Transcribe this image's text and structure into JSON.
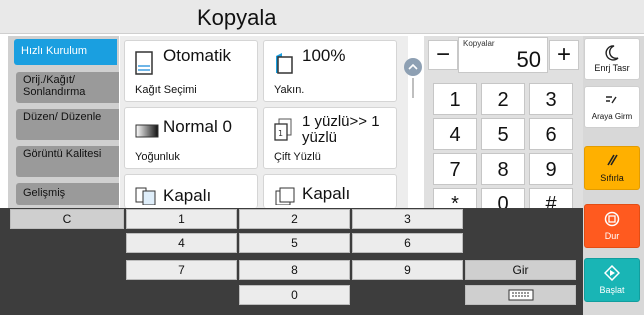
{
  "title": "Kopyala",
  "sidebar": {
    "items": [
      {
        "label": "Hızlı Kurulum",
        "active": true
      },
      {
        "label": "Orij./Kağıt/ Sonlandırma",
        "active": false
      },
      {
        "label": "Düzen/ Düzenle",
        "active": false
      },
      {
        "label": "Görüntü Kalitesi",
        "active": false
      },
      {
        "label": "Gelişmiş",
        "active": false
      }
    ]
  },
  "cards": {
    "paper": {
      "value": "Otomatik",
      "label": "Kağıt Seçimi",
      "icon": "paper-tray-icon"
    },
    "zoom": {
      "value": "100%",
      "label": "Yakın.",
      "icon": "zoom-page-icon"
    },
    "density": {
      "value": "Normal 0",
      "label": "Yoğunluk",
      "icon": "density-icon"
    },
    "duplex": {
      "value": "1 yüzlü>> 1 yüzlü",
      "label": "Çift Yüzlü",
      "icon": "duplex-icon"
    },
    "combine": {
      "value": "Kapalı",
      "icon": "combine-icon"
    },
    "staple": {
      "value": "Kapalı",
      "icon": "staple-icon"
    }
  },
  "copies": {
    "label": "Kopyalar",
    "value": "50",
    "minus": "−",
    "plus": "+"
  },
  "keypad": [
    "1",
    "2",
    "3",
    "4",
    "5",
    "6",
    "7",
    "8",
    "9",
    "*",
    "0",
    "#"
  ],
  "right_buttons": {
    "energy": {
      "label": "Enrj Tasr",
      "icon": "moon-icon"
    },
    "interrupt": {
      "label": "Araya Girm",
      "icon": "interrupt-icon"
    },
    "reset": {
      "label": "Sıfırla",
      "icon": "reset-icon",
      "color": "#ffb000"
    },
    "stop": {
      "label": "Dur",
      "icon": "stop-icon",
      "color": "#ff5a1f"
    },
    "start": {
      "label": "Başlat",
      "icon": "start-icon",
      "color": "#19b5b5"
    }
  },
  "numpad": {
    "clear": "C",
    "keys": [
      "1",
      "2",
      "3",
      "4",
      "5",
      "6",
      "7",
      "8",
      "9",
      "0"
    ],
    "enter": "Gir",
    "keyboard_icon": "keyboard-icon"
  }
}
